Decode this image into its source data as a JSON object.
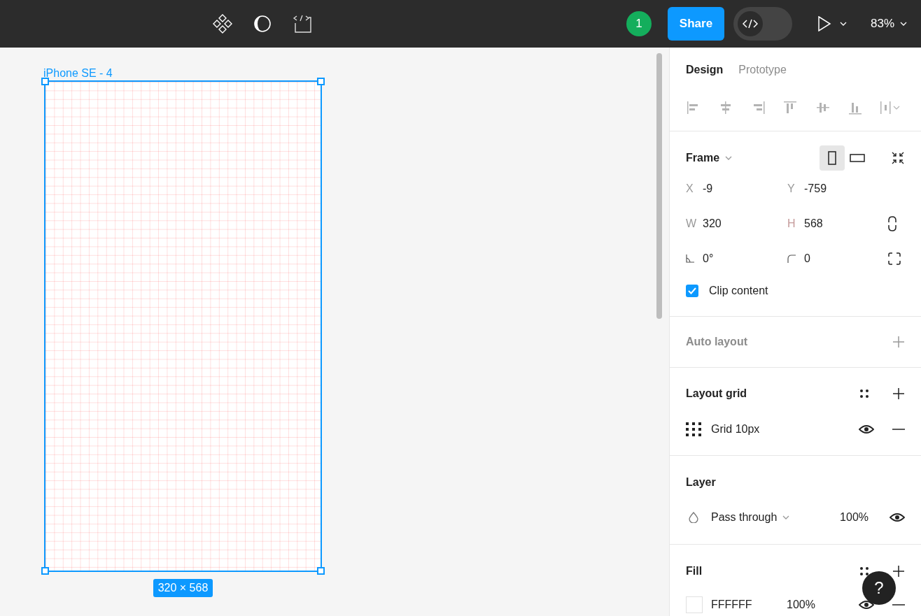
{
  "toolbar": {
    "avatar": {
      "label": "1",
      "color": "#14ae5c"
    },
    "share": "Share",
    "dev_mode": {
      "on": false
    },
    "zoom": "83%"
  },
  "canvas": {
    "frame": {
      "name": "iPhone SE - 4",
      "size": "320 × 568",
      "selected": true
    }
  },
  "panel": {
    "tabs": [
      {
        "label": "Design",
        "selected": true
      },
      {
        "label": "Prototype",
        "selected": false
      }
    ],
    "frame": {
      "title": "Frame",
      "orientation": [
        {
          "kind": "portrait",
          "selected": true
        },
        {
          "kind": "landscape",
          "selected": false
        }
      ],
      "fields": [
        {
          "kind": "text",
          "label": "X",
          "value": "-9"
        },
        {
          "kind": "text",
          "label": "Y",
          "value": "-759"
        },
        {
          "kind": "text",
          "label": "W",
          "value": "320"
        },
        {
          "kind": "text",
          "label": "H",
          "value": "568"
        },
        {
          "kind": "angle",
          "value": "0°"
        },
        {
          "kind": "radius",
          "value": "0"
        }
      ],
      "clip_content": {
        "label": "Clip content",
        "checked": true
      }
    },
    "auto_layout": {
      "title": "Auto layout"
    },
    "layout_grid": {
      "title": "Layout grid",
      "items": [
        {
          "name": "Grid 10px",
          "visible": true
        }
      ]
    },
    "layer": {
      "title": "Layer",
      "blend": "Pass through",
      "opacity": "100%",
      "visible": true
    },
    "fill": {
      "title": "Fill",
      "items": [
        {
          "hex": "FFFFFF",
          "color": "#ffffff",
          "opacity": "100%",
          "visible": true
        }
      ]
    }
  },
  "help": "?"
}
